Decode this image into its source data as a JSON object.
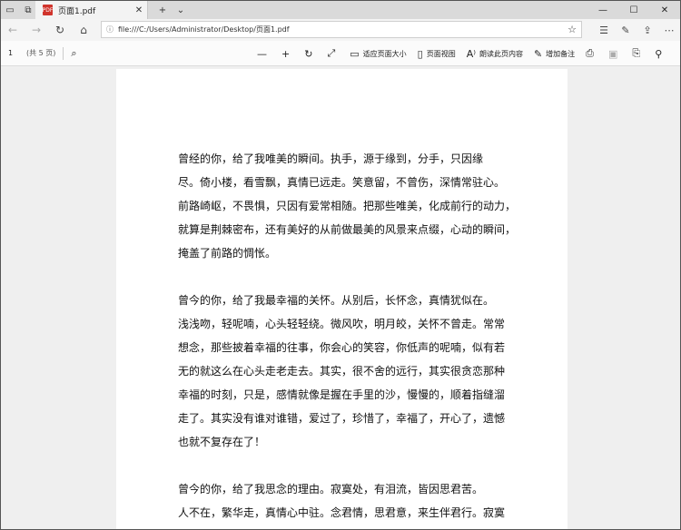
{
  "tab": {
    "title": "页面1.pdf",
    "close": "✕"
  },
  "address": {
    "url": "file:///C:/Users/Administrator/Desktop/页面1.pdf"
  },
  "pdf_toolbar": {
    "page": "1",
    "total": "(共 5 页)",
    "fit_page": "适应页面大小",
    "page_view": "页面视图",
    "read_aloud": "朗读此页内容",
    "add_notes": "增加备注"
  },
  "document": {
    "paragraphs": [
      [
        "曾经的你，给了我唯美的瞬间。执手，源于缘到，分手，只因缘",
        "尽。倚小楼，看雪飘，真情已远走。笑意留，不曾伤，深情常驻心。",
        "前路崎岖，不畏惧，只因有爱常相随。把那些唯美，化成前行的动力，",
        "就算是荆棘密布，还有美好的从前做最美的风景来点缀，心动的瞬间，",
        "掩盖了前路的惆怅。"
      ],
      [
        "曾今的你，给了我最幸福的关怀。从别后，长怀念，真情犹似在。",
        "浅浅吻，轻呢喃，心头轻轻绕。微风吹，明月皎，关怀不曾走。常常",
        "想念，那些披着幸福的往事，你会心的笑容，你低声的呢喃，似有若",
        "无的就这么在心头走老走去。其实，很不舍的远行，其实很贪恋那种",
        "幸福的时刻，只是，感情就像是握在手里的沙，慢慢的，顺着指缝溜",
        "走了。其实没有谁对谁错，爱过了，珍惜了，幸福了，开心了，遗憾",
        "也就不复存在了！"
      ],
      [
        "曾今的你，给了我思念的理由。寂寞处，有泪流，皆因思君苦。",
        "人不在，繁华走，真情心中驻。念君情，思君意，来生伴君行。寂寞"
      ]
    ]
  },
  "icons": {
    "back": "back-arrow-icon",
    "forward": "forward-arrow-icon",
    "refresh": "refresh-icon",
    "home": "home-icon"
  }
}
